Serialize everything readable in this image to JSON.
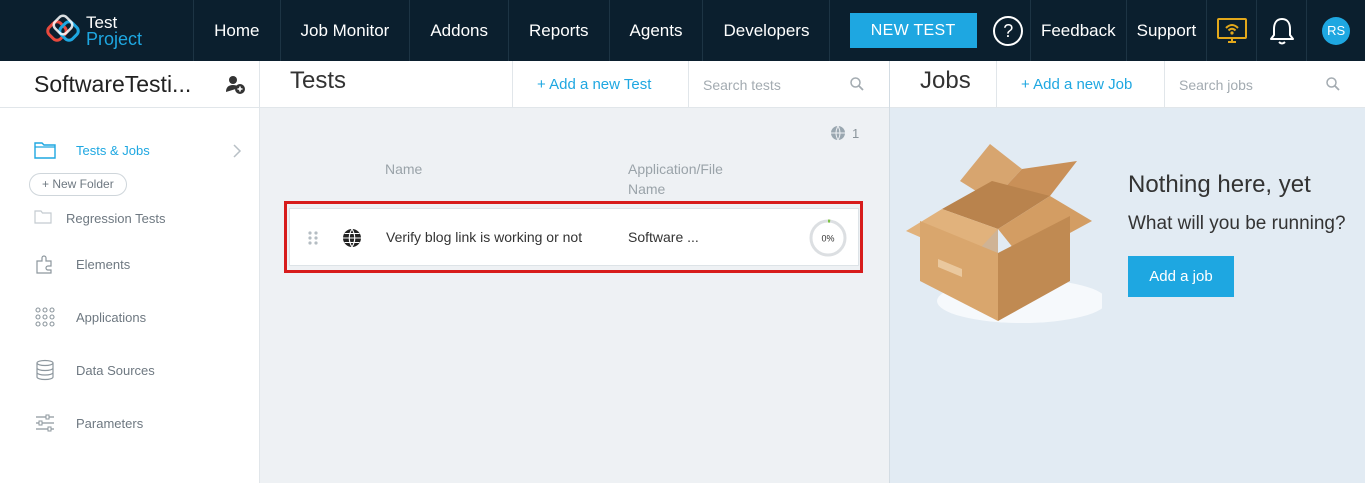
{
  "nav": {
    "logo_line1": "Test",
    "logo_line2": "Project",
    "items": [
      "Home",
      "Job Monitor",
      "Addons",
      "Reports",
      "Agents",
      "Developers"
    ],
    "new_test_label": "NEW TEST",
    "help_label": "?",
    "feedback_label": "Feedback",
    "support_label": "Support",
    "agent_icon": "monitor-wifi-icon",
    "notification_icon": "bell-icon",
    "avatar_initials": "RS"
  },
  "sidebar": {
    "project_name": "SoftwareTesti...",
    "items": [
      {
        "label": "Tests & Jobs",
        "icon": "folder-icon",
        "active": true
      },
      {
        "label": "Elements",
        "icon": "elements-icon"
      },
      {
        "label": "Applications",
        "icon": "applications-grid-icon"
      },
      {
        "label": "Data Sources",
        "icon": "database-icon"
      },
      {
        "label": "Parameters",
        "icon": "sliders-icon"
      }
    ],
    "new_folder_label": "+ New Folder",
    "folders": [
      {
        "label": "Regression Tests"
      }
    ]
  },
  "tests": {
    "title": "Tests",
    "add_label": "+  Add a new Test",
    "search_placeholder": "Search tests",
    "web_test_count": "1",
    "columns": {
      "name": "Name",
      "app_line1": "Application/File",
      "app_line2": "Name"
    },
    "rows": [
      {
        "name": "Verify blog link is working or not",
        "application": "Software ...",
        "progress_label": "0%",
        "progress": 0
      }
    ]
  },
  "jobs": {
    "title": "Jobs",
    "add_label": "+  Add a new Job",
    "search_placeholder": "Search jobs",
    "empty_title": "Nothing here, yet",
    "empty_subtitle": "What will you be running?",
    "add_job_label": "Add a job"
  },
  "colors": {
    "nav_bg": "#0b1f2e",
    "accent": "#1ea7e1",
    "highlight": "#d71c1c",
    "jobs_bg": "#e2ebf3"
  }
}
